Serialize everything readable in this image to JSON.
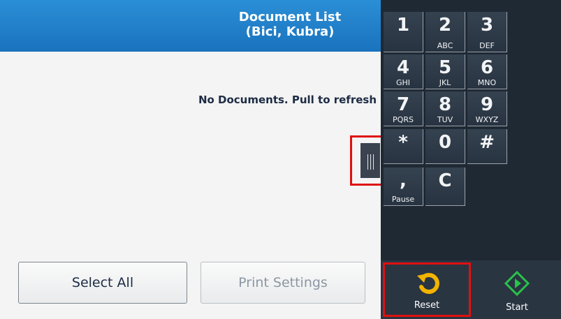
{
  "header": {
    "title_line1": "Document List",
    "title_line2": "(Bici, Kubra)"
  },
  "main": {
    "empty_message": "No Documents. Pull to refresh"
  },
  "buttons": {
    "select_all": "Select All",
    "print_settings": "Print Settings"
  },
  "keypad": {
    "keys": [
      {
        "digit": "1",
        "letters": ""
      },
      {
        "digit": "2",
        "letters": "ABC"
      },
      {
        "digit": "3",
        "letters": "DEF"
      },
      {
        "digit": "4",
        "letters": "GHI"
      },
      {
        "digit": "5",
        "letters": "JKL"
      },
      {
        "digit": "6",
        "letters": "MNO"
      },
      {
        "digit": "7",
        "letters": "PQRS"
      },
      {
        "digit": "8",
        "letters": "TUV"
      },
      {
        "digit": "9",
        "letters": "WXYZ"
      },
      {
        "digit": "*",
        "letters": ""
      },
      {
        "digit": "0",
        "letters": ""
      },
      {
        "digit": "#",
        "letters": ""
      },
      {
        "digit": ",",
        "letters": "Pause"
      },
      {
        "digit": "C",
        "letters": ""
      }
    ]
  },
  "controls": {
    "reset_label": "Reset",
    "start_label": "Start"
  },
  "colors": {
    "header_blue": "#1a72bd",
    "highlight_red": "#e01010",
    "reset_yellow": "#f2b400",
    "start_green": "#29c24a"
  },
  "icons": {
    "reset": "reset-arrow-icon",
    "start": "start-diamond-icon",
    "handle": "drag-handle-icon"
  }
}
